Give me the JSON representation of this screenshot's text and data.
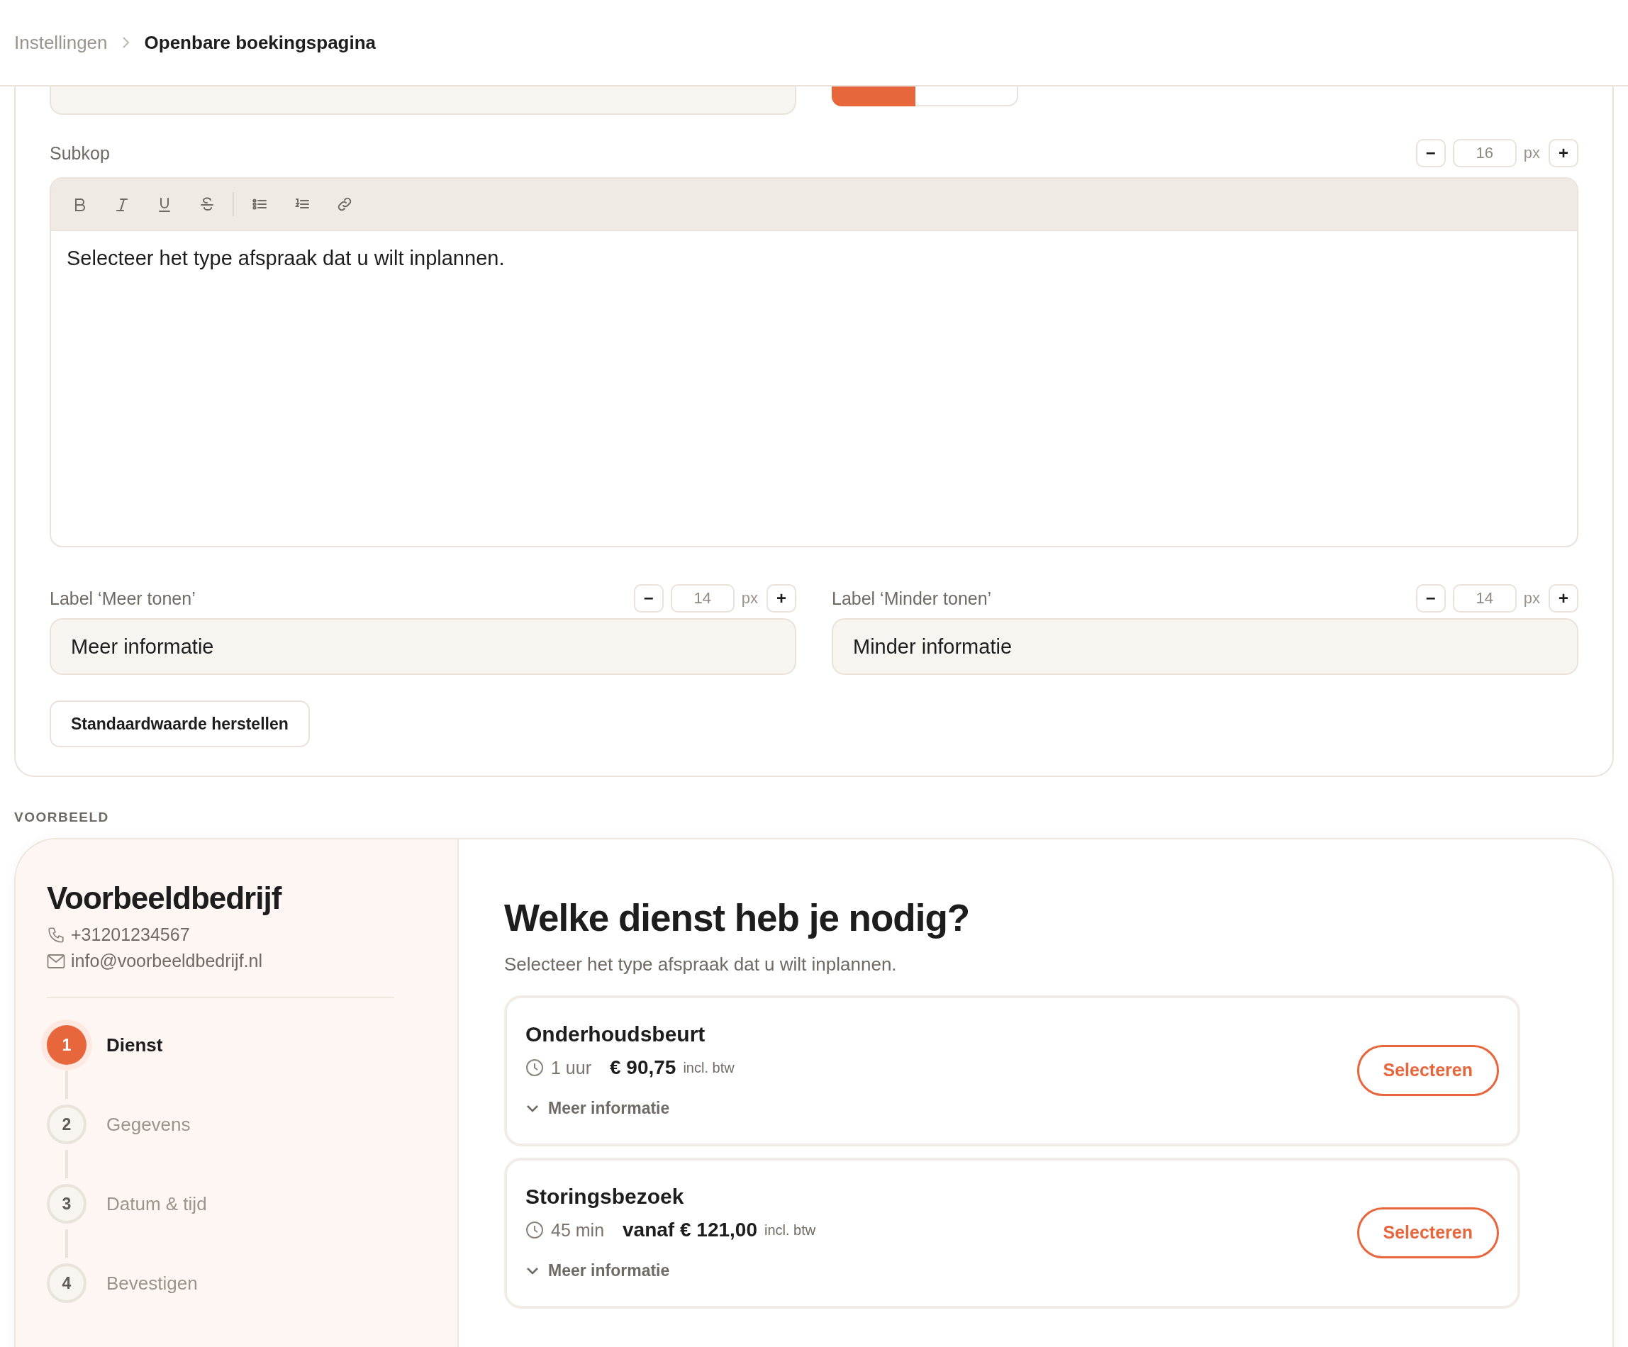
{
  "breadcrumb": [
    {
      "label": "Instellingen",
      "current": false
    },
    {
      "label": "Openbare boekingspagina",
      "current": true
    }
  ],
  "layout_toggle": {
    "options": [
      {
        "selected": true
      },
      {
        "selected": false
      }
    ]
  },
  "subheading": {
    "label": "Subkop",
    "size": {
      "minus": "−",
      "value": "16",
      "unit": "px",
      "plus": "+"
    },
    "text": "Selecteer het type afspraak dat u wilt inplannen."
  },
  "more_label": {
    "label": "Label ‘Meer tonen’",
    "size": {
      "minus": "−",
      "value": "14",
      "unit": "px",
      "plus": "+"
    },
    "value": "Meer informatie"
  },
  "less_label": {
    "label": "Label ‘Minder tonen’",
    "size": {
      "minus": "−",
      "value": "14",
      "unit": "px",
      "plus": "+"
    },
    "value": "Minder informatie"
  },
  "reset_button": "Standaardwaarde herstellen",
  "preview": {
    "section_label": "VOORBEELD",
    "company": {
      "name": "Voorbeeldbedrijf",
      "phone": "+31201234567",
      "email": "info@voorbeeldbedrijf.nl"
    },
    "steps": [
      {
        "number": "1",
        "label": "Dienst",
        "selected": true
      },
      {
        "number": "2",
        "label": "Gegevens",
        "selected": false
      },
      {
        "number": "3",
        "label": "Datum & tijd",
        "selected": false
      },
      {
        "number": "4",
        "label": "Bevestigen",
        "selected": false
      }
    ],
    "title": "Welke dienst heb je nodig?",
    "subtitle": "Selecteer het type afspraak dat u wilt inplannen.",
    "services": [
      {
        "name": "Onderhoudsbeurt",
        "duration": "1 uur",
        "price": "€ 90,75",
        "tax_note": "incl. btw",
        "more": "Meer informatie",
        "button": "Selecteren"
      },
      {
        "name": "Storingsbezoek",
        "duration": "45 min",
        "price": "vanaf € 121,00",
        "tax_note": "incl. btw",
        "more": "Meer informatie",
        "button": "Selecteren"
      }
    ]
  }
}
